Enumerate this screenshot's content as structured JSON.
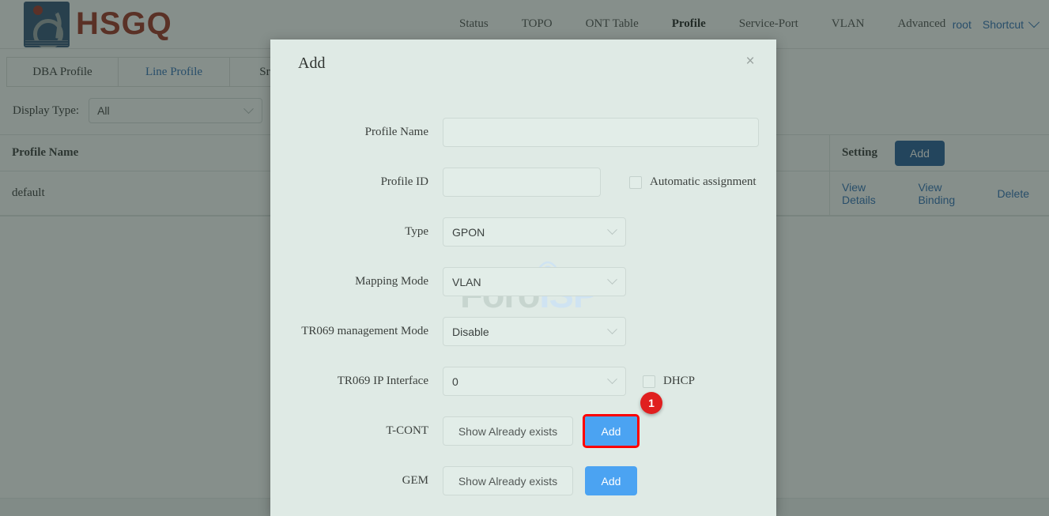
{
  "header": {
    "brand": "HSGQ",
    "nav_items": [
      {
        "label": "Status",
        "active": false
      },
      {
        "label": "TOPO",
        "active": false
      },
      {
        "label": "ONT Table",
        "active": false
      },
      {
        "label": "Profile",
        "active": true
      },
      {
        "label": "Service-Port",
        "active": false
      },
      {
        "label": "VLAN",
        "active": false
      },
      {
        "label": "Advanced",
        "active": false
      }
    ],
    "user": "root",
    "shortcut": "Shortcut"
  },
  "tabs": [
    {
      "label": "DBA Profile",
      "active": false
    },
    {
      "label": "Line Profile",
      "active": true
    },
    {
      "label": "Srv Profile",
      "active": false
    }
  ],
  "filter": {
    "label": "Display Type:",
    "value": "All"
  },
  "table": {
    "columns": [
      "Profile Name",
      "Setting"
    ],
    "add_label": "Add",
    "rows": [
      {
        "profile_name": "default",
        "actions": [
          "View Details",
          "View Binding",
          "Delete"
        ]
      }
    ]
  },
  "modal": {
    "title": "Add",
    "close": "×",
    "watermark_foro": "Foro",
    "watermark_isp": "ISP",
    "fields": {
      "profile_name": {
        "label": "Profile Name",
        "value": "",
        "placeholder": ""
      },
      "profile_id": {
        "label": "Profile ID",
        "value": "",
        "placeholder": ""
      },
      "automatic_assignment": {
        "label": "Automatic assignment",
        "checked": false
      },
      "type": {
        "label": "Type",
        "value": "GPON"
      },
      "mapping_mode": {
        "label": "Mapping Mode",
        "value": "VLAN"
      },
      "tr069_management_mode": {
        "label": "TR069 management Mode",
        "value": "Disable"
      },
      "tr069_ip_interface": {
        "label": "TR069 IP Interface",
        "value": "0"
      },
      "dhcp": {
        "label": "DHCP",
        "checked": false
      },
      "tcont": {
        "label": "T-CONT",
        "show_label": "Show Already exists",
        "add_label": "Add",
        "badge": "1"
      },
      "gem": {
        "label": "GEM",
        "show_label": "Show Already exists",
        "add_label": "Add"
      }
    }
  },
  "colors": {
    "brand_red": "#9c2a19",
    "logo_blue": "#2a4d73",
    "link_blue": "#2b6cb5",
    "table_add_blue": "#1f5896",
    "modal_btn_blue": "#4ba3f2",
    "highlight_red": "#ff0000",
    "badge_red": "#e01f1f",
    "modal_bg": "#dfeae5"
  }
}
